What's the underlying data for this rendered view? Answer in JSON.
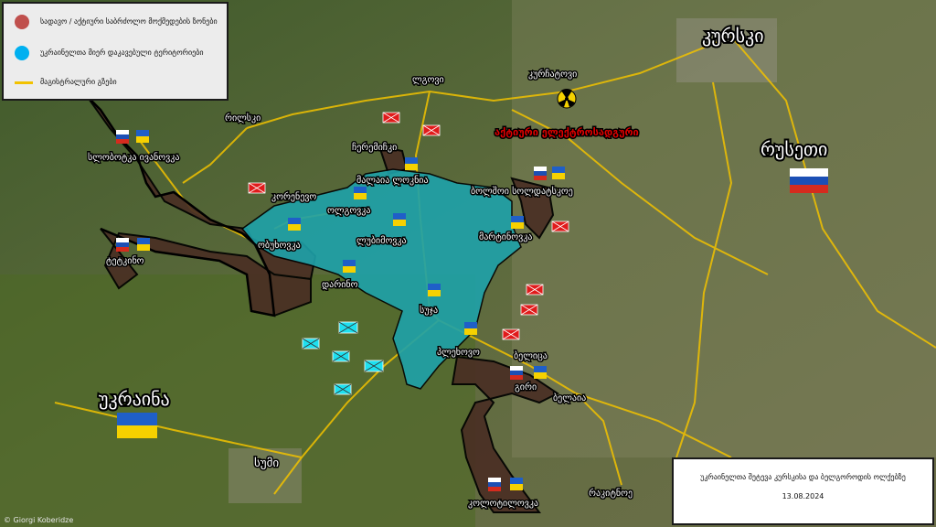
{
  "legend": {
    "items": [
      {
        "label": "სადავო / აქტიური საბრძოლო მოქმედების ზონები",
        "color": "#c0504d",
        "kind": "dot"
      },
      {
        "label": "უკრაინელთა მიერ დაკავებული ტერიტორიები",
        "color": "#00b0f0",
        "kind": "dot"
      },
      {
        "label": "მაგისტრალური გზები",
        "color": "#f2c200",
        "kind": "line"
      }
    ]
  },
  "labels": {
    "kursk": "კურსკი",
    "russia": "რუსეთი",
    "ukraine": "უკრაინა",
    "sumy": "სუმი",
    "kurchatov": "კურჩატოვი",
    "lgov": "ლგოვი",
    "rylsk": "რილსკი",
    "sl_ivanovka": "სლობოტკა ივანოვკა",
    "tetkino": "ტეტკინო",
    "korenevo": "კორენევო",
    "obukhovka": "ობუხოვკა",
    "olgovka": "ოლგოვკა",
    "lyubimovka": "ლუბიმოვკა",
    "darino": "დარინო",
    "sudzha": "სუჯა",
    "plekhovo": "პლეხოვო",
    "belitsa": "ბელიცა",
    "gira": "გირი",
    "belaya": "ბელაია",
    "kolotilovka": "კოლოტილოვკა",
    "rakitnoe": "რაკიტნოე",
    "martynovka": "მარტინოვკა",
    "bolshoe_soldatskoe": "ბოლშოი სოლდატსკოე",
    "malaya_loknya": "მალაია ლოკნია",
    "snagost": "ჩერემიჩკი",
    "npp_note": "აქტიური ელექტროსადგური"
  },
  "info": {
    "title": "უკრაინელთა შეტევა კურსკისა და ბელგოროდის ოლქებზე",
    "date": "13.08.2024"
  },
  "credit": "© Giorgi Koberidze",
  "colors": {
    "contested": "#4a2f24",
    "occupied": "#1e9ba0",
    "road": "#f2c200",
    "boundary": "#000000"
  }
}
